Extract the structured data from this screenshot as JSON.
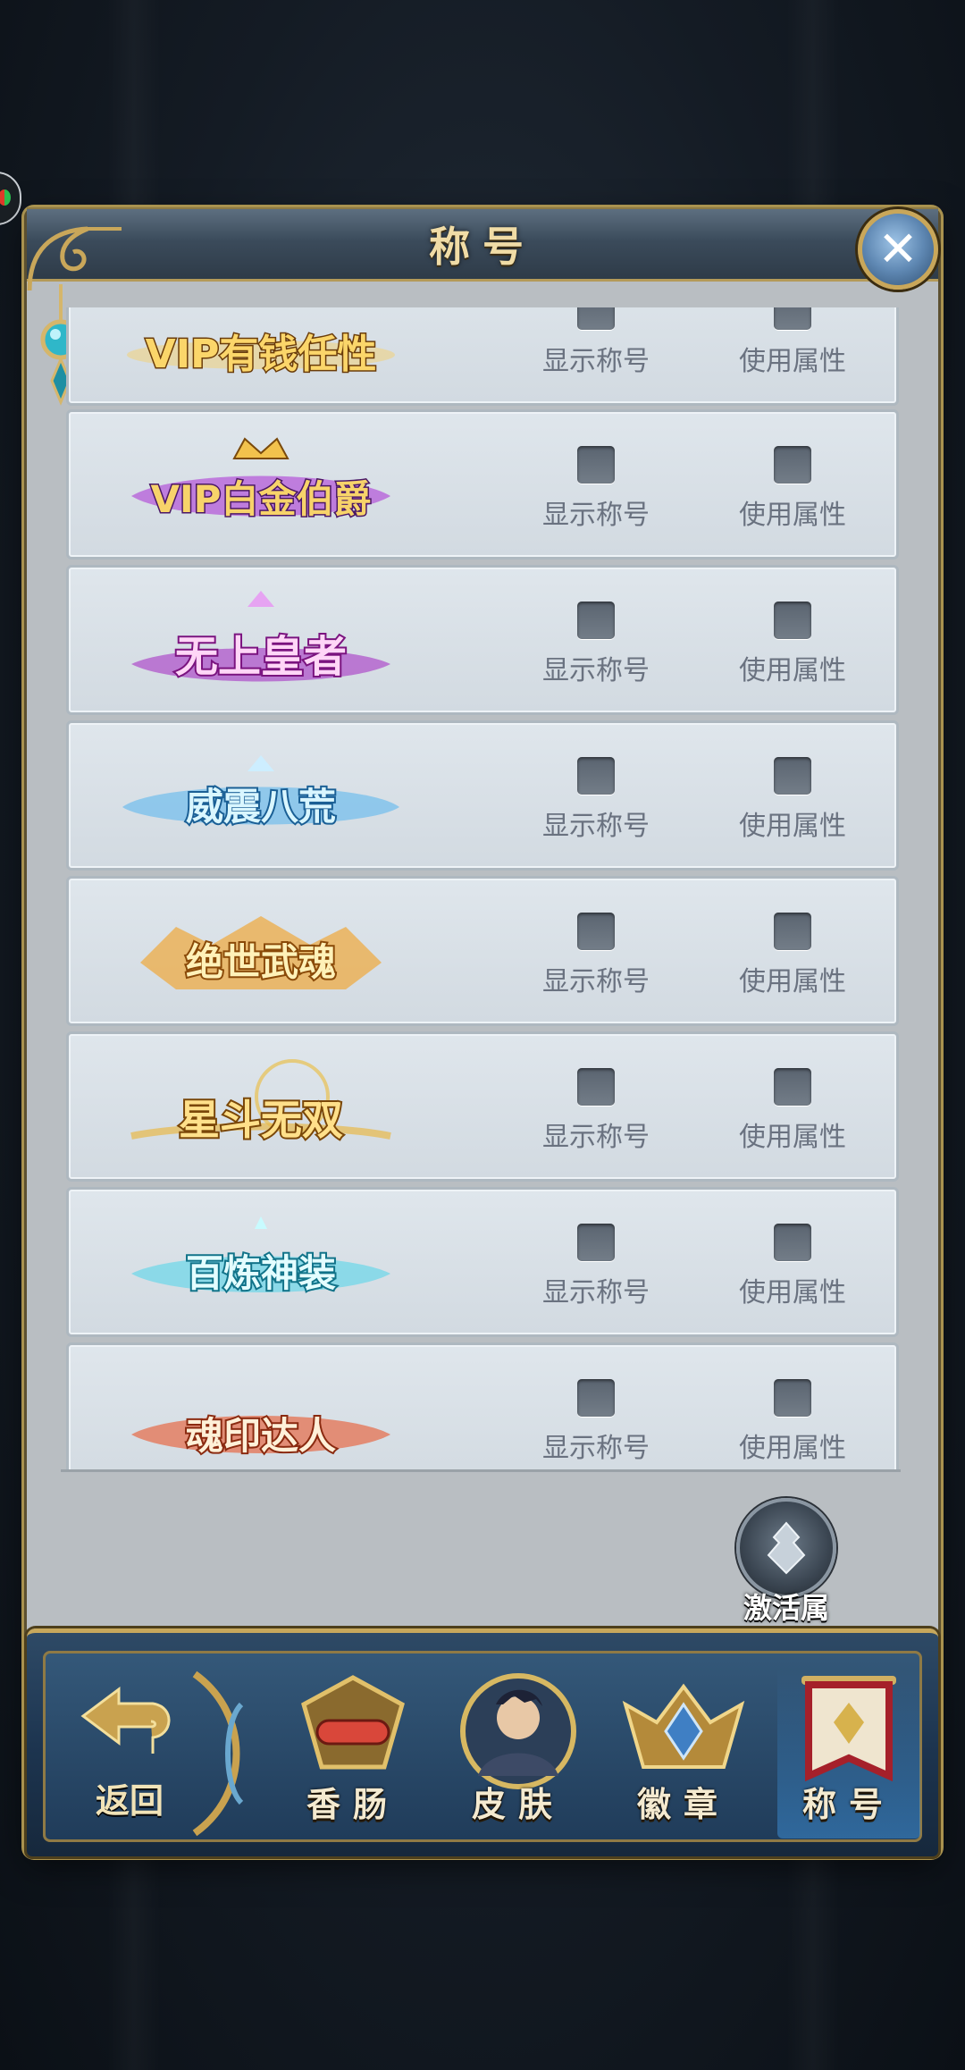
{
  "title": "称号",
  "rows": [
    {
      "badge_text": "VIP有钱任性",
      "show_label": "显示称号",
      "use_label": "使用属性"
    },
    {
      "badge_text": "VIP白金伯爵",
      "show_label": "显示称号",
      "use_label": "使用属性"
    },
    {
      "badge_text": "无上皇者",
      "show_label": "显示称号",
      "use_label": "使用属性"
    },
    {
      "badge_text": "威震八荒",
      "show_label": "显示称号",
      "use_label": "使用属性"
    },
    {
      "badge_text": "绝世武魂",
      "show_label": "显示称号",
      "use_label": "使用属性"
    },
    {
      "badge_text": "星斗无双",
      "show_label": "显示称号",
      "use_label": "使用属性"
    },
    {
      "badge_text": "百炼神装",
      "show_label": "显示称号",
      "use_label": "使用属性"
    },
    {
      "badge_text": "魂印达人",
      "show_label": "显示称号",
      "use_label": "使用属性"
    }
  ],
  "activate_label": "激活属性",
  "back_label": "返回",
  "tabs": [
    {
      "label": "香肠",
      "icon": "sausage-crest-icon"
    },
    {
      "label": "皮肤",
      "icon": "skin-portrait-icon"
    },
    {
      "label": "徽章",
      "icon": "badge-crest-icon"
    },
    {
      "label": "称号",
      "icon": "title-banner-icon",
      "active": true
    }
  ],
  "colors": {
    "gold": "#f0dca6",
    "panel": "#b9bec2",
    "row": "#dfe6ec",
    "checkbox": "#5a6470",
    "label": "#6a7280"
  }
}
